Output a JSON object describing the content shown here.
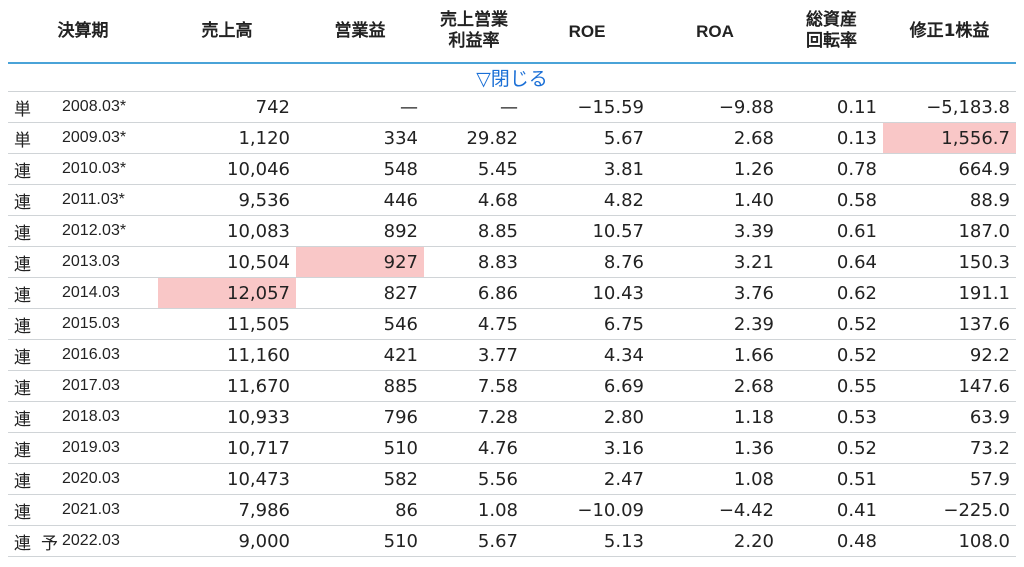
{
  "headers": {
    "period": "決算期",
    "sales": "売上高",
    "operating_profit": "営業益",
    "op_margin_line1": "売上営業",
    "op_margin_line2": "利益率",
    "roe": "ROE",
    "roa": "ROA",
    "turnover_line1": "総資産",
    "turnover_line2": "回転率",
    "eps": "修正1株益"
  },
  "close_label": "▽閉じる",
  "highlight_color": "#f9c7c7",
  "accent_color": "#4aa3d8",
  "link_color": "#1a6fd6",
  "rows": [
    {
      "type": "単",
      "forecast": "",
      "period": "2008.03*",
      "sales": "742",
      "op": "—",
      "margin": "—",
      "roe": "−15.59",
      "roa": "−9.88",
      "turnover": "0.11",
      "eps": "−5,183.8",
      "hl": []
    },
    {
      "type": "単",
      "forecast": "",
      "period": "2009.03*",
      "sales": "1,120",
      "op": "334",
      "margin": "29.82",
      "roe": "5.67",
      "roa": "2.68",
      "turnover": "0.13",
      "eps": "1,556.7",
      "hl": [
        "eps"
      ]
    },
    {
      "type": "連",
      "forecast": "",
      "period": "2010.03*",
      "sales": "10,046",
      "op": "548",
      "margin": "5.45",
      "roe": "3.81",
      "roa": "1.26",
      "turnover": "0.78",
      "eps": "664.9",
      "hl": []
    },
    {
      "type": "連",
      "forecast": "",
      "period": "2011.03*",
      "sales": "9,536",
      "op": "446",
      "margin": "4.68",
      "roe": "4.82",
      "roa": "1.40",
      "turnover": "0.58",
      "eps": "88.9",
      "hl": []
    },
    {
      "type": "連",
      "forecast": "",
      "period": "2012.03*",
      "sales": "10,083",
      "op": "892",
      "margin": "8.85",
      "roe": "10.57",
      "roa": "3.39",
      "turnover": "0.61",
      "eps": "187.0",
      "hl": []
    },
    {
      "type": "連",
      "forecast": "",
      "period": "2013.03",
      "sales": "10,504",
      "op": "927",
      "margin": "8.83",
      "roe": "8.76",
      "roa": "3.21",
      "turnover": "0.64",
      "eps": "150.3",
      "hl": [
        "op"
      ]
    },
    {
      "type": "連",
      "forecast": "",
      "period": "2014.03",
      "sales": "12,057",
      "op": "827",
      "margin": "6.86",
      "roe": "10.43",
      "roa": "3.76",
      "turnover": "0.62",
      "eps": "191.1",
      "hl": [
        "sales"
      ]
    },
    {
      "type": "連",
      "forecast": "",
      "period": "2015.03",
      "sales": "11,505",
      "op": "546",
      "margin": "4.75",
      "roe": "6.75",
      "roa": "2.39",
      "turnover": "0.52",
      "eps": "137.6",
      "hl": []
    },
    {
      "type": "連",
      "forecast": "",
      "period": "2016.03",
      "sales": "11,160",
      "op": "421",
      "margin": "3.77",
      "roe": "4.34",
      "roa": "1.66",
      "turnover": "0.52",
      "eps": "92.2",
      "hl": []
    },
    {
      "type": "連",
      "forecast": "",
      "period": "2017.03",
      "sales": "11,670",
      "op": "885",
      "margin": "7.58",
      "roe": "6.69",
      "roa": "2.68",
      "turnover": "0.55",
      "eps": "147.6",
      "hl": []
    },
    {
      "type": "連",
      "forecast": "",
      "period": "2018.03",
      "sales": "10,933",
      "op": "796",
      "margin": "7.28",
      "roe": "2.80",
      "roa": "1.18",
      "turnover": "0.53",
      "eps": "63.9",
      "hl": []
    },
    {
      "type": "連",
      "forecast": "",
      "period": "2019.03",
      "sales": "10,717",
      "op": "510",
      "margin": "4.76",
      "roe": "3.16",
      "roa": "1.36",
      "turnover": "0.52",
      "eps": "73.2",
      "hl": []
    },
    {
      "type": "連",
      "forecast": "",
      "period": "2020.03",
      "sales": "10,473",
      "op": "582",
      "margin": "5.56",
      "roe": "2.47",
      "roa": "1.08",
      "turnover": "0.51",
      "eps": "57.9",
      "hl": []
    },
    {
      "type": "連",
      "forecast": "",
      "period": "2021.03",
      "sales": "7,986",
      "op": "86",
      "margin": "1.08",
      "roe": "−10.09",
      "roa": "−4.42",
      "turnover": "0.41",
      "eps": "−225.0",
      "hl": []
    },
    {
      "type": "連",
      "forecast": "予",
      "period": "2022.03",
      "sales": "9,000",
      "op": "510",
      "margin": "5.67",
      "roe": "5.13",
      "roa": "2.20",
      "turnover": "0.48",
      "eps": "108.0",
      "hl": []
    }
  ]
}
